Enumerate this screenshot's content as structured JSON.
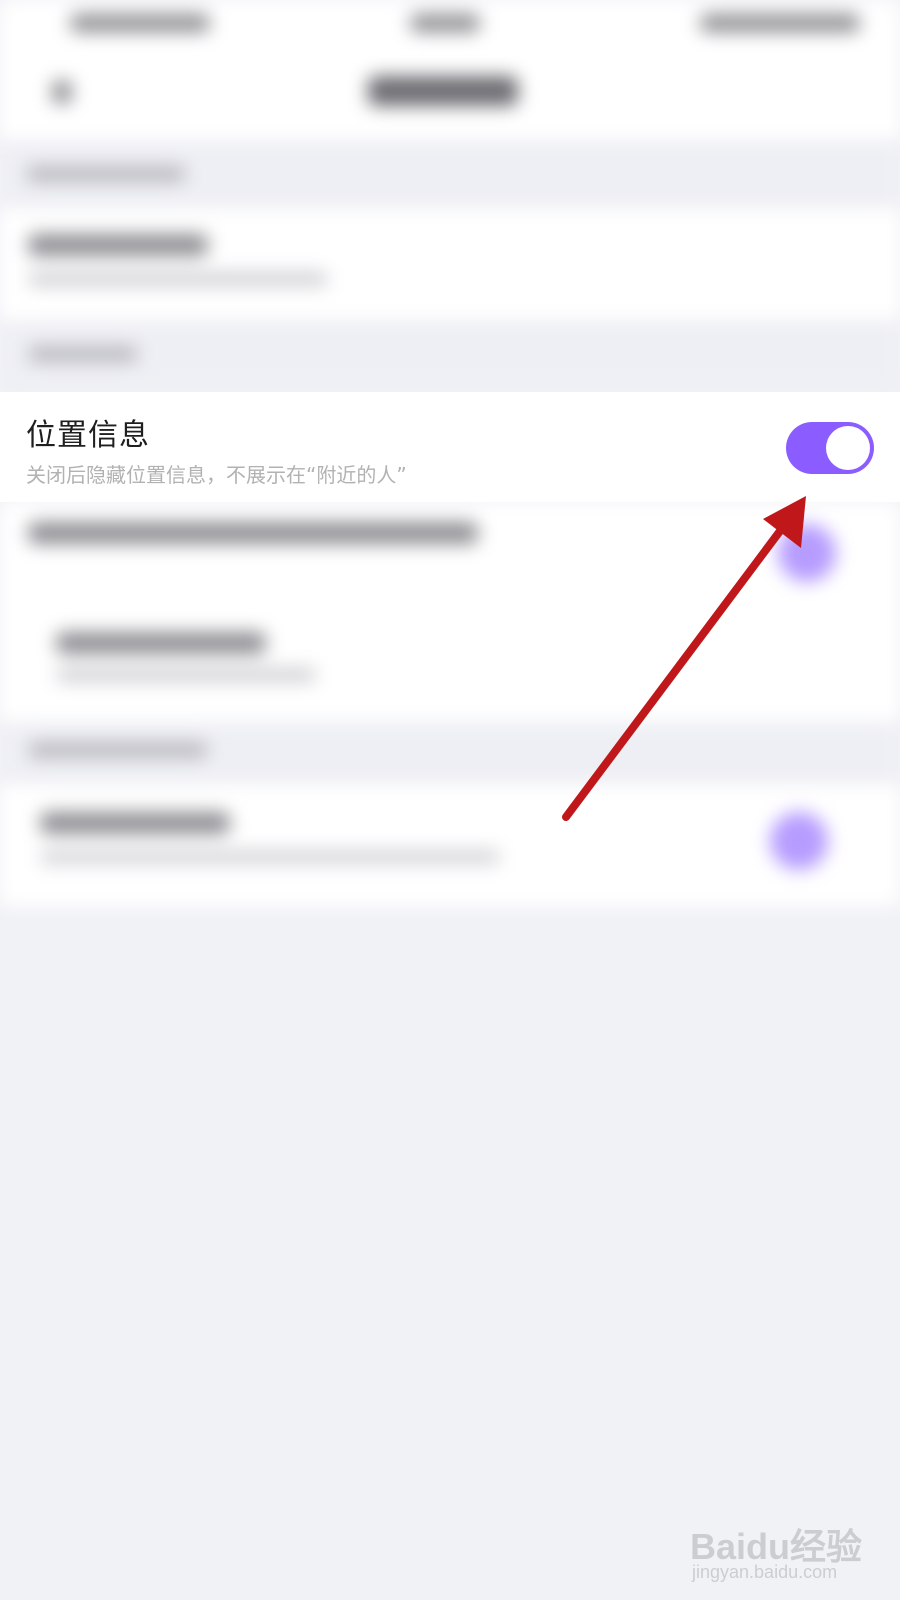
{
  "setting": {
    "title": "位置信息",
    "description": "关闭后隐藏位置信息，不展示在“附近的人”",
    "toggle_on": true,
    "toggle_color": "#8b5cff"
  },
  "annotation": {
    "arrow_color": "#c0181a"
  },
  "watermark": {
    "brand": "Baidu经验",
    "url": "jingyan.baidu.com"
  }
}
